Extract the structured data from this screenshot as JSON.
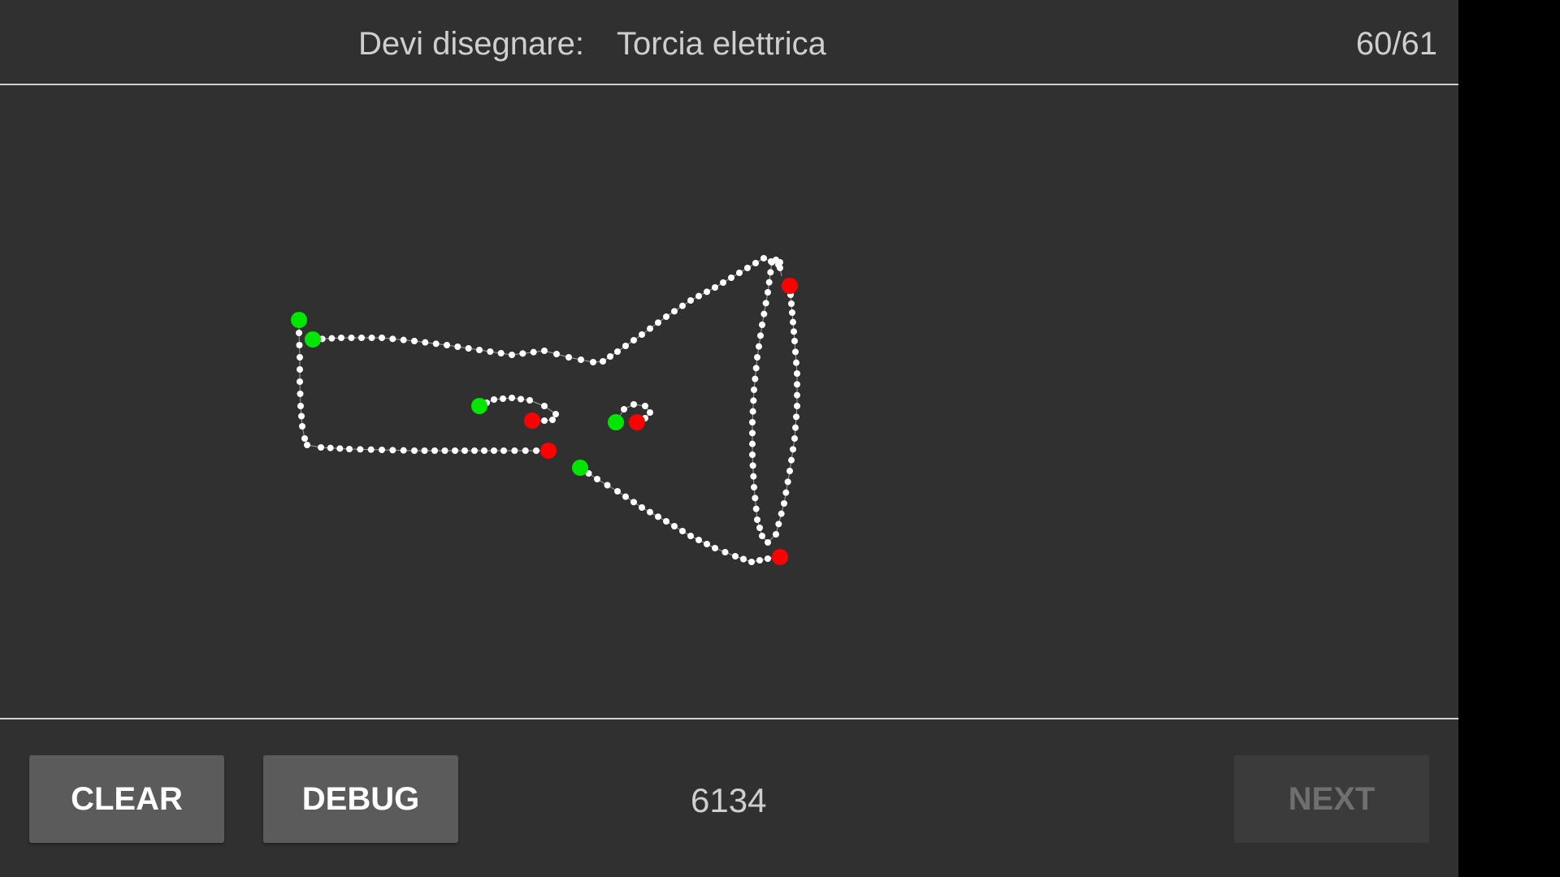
{
  "header": {
    "prompt_label": "Devi disegnare:",
    "prompt_word": "Torcia elettrica",
    "progress": "60/61"
  },
  "footer": {
    "clear_label": "CLEAR",
    "debug_label": "DEBUG",
    "score": "6134",
    "next_label": "NEXT",
    "next_enabled": false
  },
  "colors": {
    "background": "#303030",
    "stroke_point": "#ffffff",
    "stroke_start": "#00e600",
    "stroke_end": "#ff0000"
  }
}
